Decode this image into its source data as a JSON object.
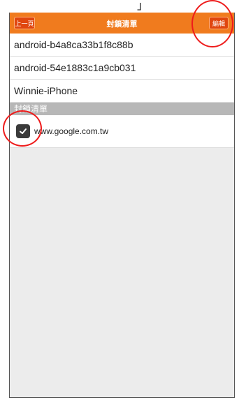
{
  "caption_fragment": "」",
  "header": {
    "back_label": "上一頁",
    "title": "封鎖清單",
    "edit_label": "編輯"
  },
  "devices": [
    "android-b4a8ca33b1f8c88b",
    "android-54e1883c1a9cb031",
    "Winnie-iPhone"
  ],
  "blocked_section": {
    "title": "封鎖清單",
    "items": [
      {
        "label": "www.google.com.tw",
        "checked": true
      }
    ]
  },
  "colors": {
    "header_bg": "#f07b1e",
    "button_bg": "#e0460f",
    "section_bg": "#b7b7b7",
    "annotation": "#ee1b1b"
  }
}
